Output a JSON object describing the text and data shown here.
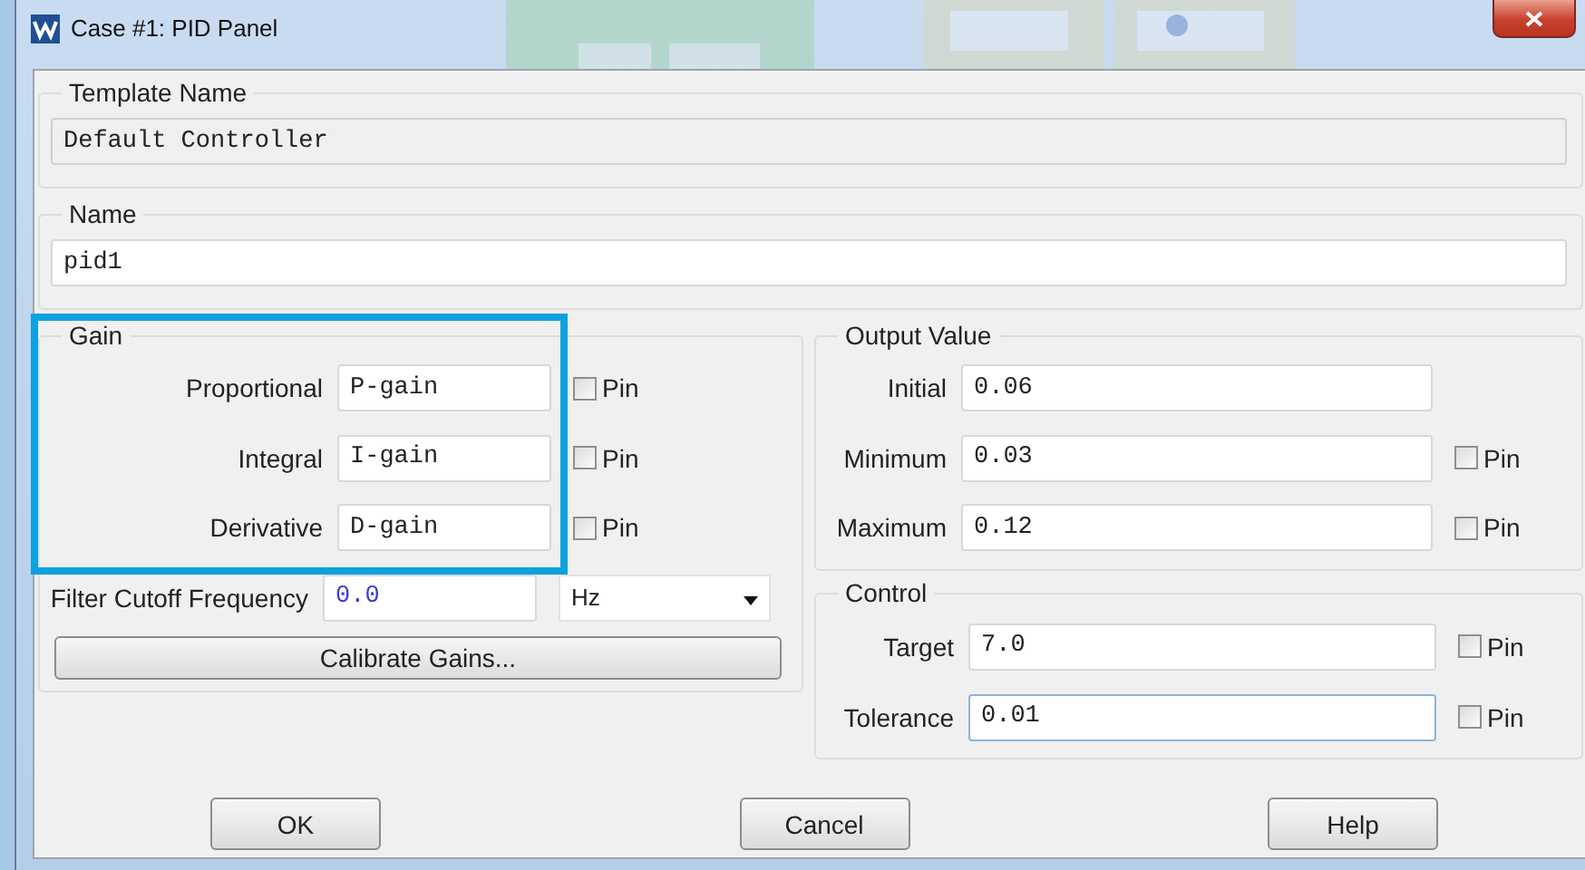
{
  "window": {
    "title": "Case #1: PID Panel"
  },
  "template_name": {
    "label": "Template Name",
    "value": "Default Controller",
    "disabled": true
  },
  "name": {
    "label": "Name",
    "value": "pid1"
  },
  "gain": {
    "label": "Gain",
    "highlighted": true,
    "rows": [
      {
        "label": "Proportional",
        "value": "P-gain",
        "pin_label": "Pin",
        "pinned": false
      },
      {
        "label": "Integral",
        "value": "I-gain",
        "pin_label": "Pin",
        "pinned": false
      },
      {
        "label": "Derivative",
        "value": "D-gain",
        "pin_label": "Pin",
        "pinned": false
      }
    ]
  },
  "filter": {
    "label": "Filter Cutoff Frequency",
    "value": "0.0",
    "unit": "Hz"
  },
  "calibrate_button": "Calibrate Gains...",
  "output_value": {
    "label": "Output Value",
    "rows": [
      {
        "label": "Initial",
        "value": "0.06"
      },
      {
        "label": "Minimum",
        "value": "0.03",
        "pin_label": "Pin",
        "pinned": false
      },
      {
        "label": "Maximum",
        "value": "0.12",
        "pin_label": "Pin",
        "pinned": false
      }
    ]
  },
  "control": {
    "label": "Control",
    "rows": [
      {
        "label": "Target",
        "value": "7.0",
        "pin_label": "Pin",
        "pinned": false,
        "focused": false
      },
      {
        "label": "Tolerance",
        "value": "0.01",
        "pin_label": "Pin",
        "pinned": false,
        "focused": true
      }
    ]
  },
  "buttons": [
    "OK",
    "Cancel",
    "Help"
  ]
}
